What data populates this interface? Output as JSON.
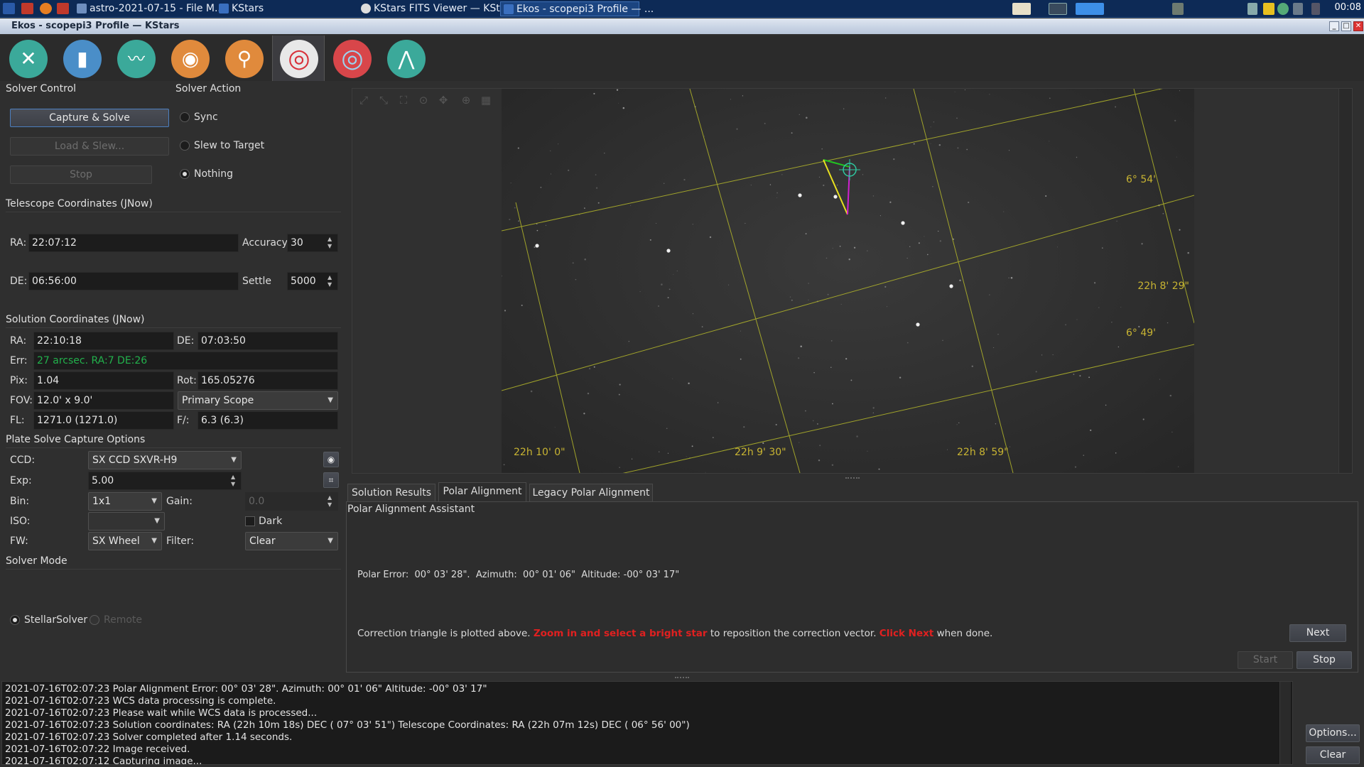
{
  "taskbar": {
    "tasks": [
      {
        "label": "astro-2021-07-15 - File M..."
      },
      {
        "label": "KStars"
      },
      {
        "label": "KStars FITS Viewer — KSt..."
      },
      {
        "label": "Ekos - scopepi3 Profile — ..."
      }
    ],
    "clock": "00:08"
  },
  "window": {
    "title": "Ekos - scopepi3 Profile — KStars"
  },
  "modules": [
    {
      "icon": "setup-tools-icon"
    },
    {
      "icon": "scheduler-notebook-icon"
    },
    {
      "icon": "analyze-graph-icon"
    },
    {
      "icon": "capture-camera-icon"
    },
    {
      "icon": "focus-magnifier-icon"
    },
    {
      "icon": "align-target-icon"
    },
    {
      "icon": "guide-target-icon"
    },
    {
      "icon": "mount-telescope-icon"
    }
  ],
  "solver_control": {
    "heading": "Solver Control",
    "capture_solve": "Capture & Solve",
    "load_slew": "Load & Slew...",
    "stop": "Stop"
  },
  "solver_action": {
    "heading": "Solver Action",
    "options": [
      "Sync",
      "Slew to Target",
      "Nothing"
    ],
    "selected": "Nothing"
  },
  "telescope": {
    "heading": "Telescope Coordinates (JNow)",
    "ra_label": "RA:",
    "ra": "22:07:12",
    "de_label": "DE:",
    "de": "06:56:00",
    "accuracy_label": "Accuracy",
    "accuracy": "30",
    "settle_label": "Settle",
    "settle": "5000"
  },
  "solution": {
    "heading": "Solution Coordinates (JNow)",
    "ra_label": "RA:",
    "ra": "22:10:18",
    "de_label": "DE:",
    "de": "07:03:50",
    "err_label": "Err:",
    "err": "27 arcsec. RA:7 DE:26",
    "pix_label": "Pix:",
    "pix": "1.04",
    "rot_label": "Rot:",
    "rot": "165.05276",
    "fov_label": "FOV:",
    "fov": "12.0' x 9.0'",
    "scope": "Primary Scope",
    "fl_label": "FL:",
    "fl": "1271.0 (1271.0)",
    "f_label": "F/:",
    "f": "6.3 (6.3)"
  },
  "capture_options": {
    "heading": "Plate Solve Capture Options",
    "ccd_label": "CCD:",
    "ccd": "SX CCD SXVR-H9",
    "exp_label": "Exp:",
    "exp": "5.00",
    "bin_label": "Bin:",
    "bin": "1x1",
    "gain_label": "Gain:",
    "gain": "0.0",
    "iso_label": "ISO:",
    "iso": "",
    "dark_label": "Dark",
    "fw_label": "FW:",
    "fw": "SX Wheel",
    "filter_label": "Filter:",
    "filter": "Clear"
  },
  "solver_mode": {
    "heading": "Solver Mode",
    "options": [
      "StellarSolver",
      "Remote"
    ],
    "selected": "StellarSolver"
  },
  "fits_overlay": {
    "labels": [
      "6° 54'",
      "22h 8' 29\"",
      "6° 49'",
      "22h 10' 0\"",
      "22h 9' 30\"",
      "22h 8' 59\""
    ],
    "grid_color": "#b5b82a",
    "label_color": "#c8b432"
  },
  "tabs": [
    "Solution Results",
    "Polar Alignment",
    "Legacy Polar Alignment"
  ],
  "active_tab": "Polar Alignment",
  "polar": {
    "heading": "Polar Alignment Assistant",
    "error_line": "Polar Error:  00° 03' 28\".  Azimuth:  00° 01' 06\"  Altitude: -00° 03' 17\"",
    "correction_prefix": "Correction triangle is plotted above.",
    "correction_red1": "Zoom in and select a bright star",
    "correction_mid": "to reposition the correction vector.",
    "correction_red2": "Click Next",
    "correction_suffix": "when done.",
    "next": "Next",
    "start": "Start",
    "stop": "Stop"
  },
  "log": {
    "lines": [
      "2021-07-16T02:07:23 Polar Alignment Error:  00° 03' 28\". Azimuth:  00° 01' 06\"  Altitude: -00° 03' 17\"",
      "2021-07-16T02:07:23 WCS data processing is complete.",
      "2021-07-16T02:07:23 Please wait while WCS data is processed...",
      "2021-07-16T02:07:23 Solution coordinates: RA (22h 10m 18s) DEC ( 07° 03' 51\") Telescope Coordinates: RA (22h 07m 12s) DEC ( 06° 56' 00\")",
      "2021-07-16T02:07:23 Solver completed after 1.14 seconds.",
      "2021-07-16T02:07:22 Image received.",
      "2021-07-16T02:07:12 Capturing image..."
    ],
    "options": "Options...",
    "clear": "Clear"
  },
  "colors": {
    "accent": "#4c7fbf",
    "error_text": "#e02020",
    "err_green": "#22b14c"
  }
}
